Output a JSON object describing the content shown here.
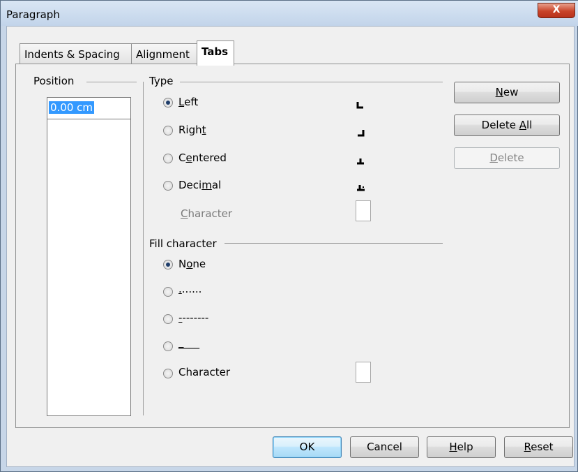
{
  "window": {
    "title": "Paragraph",
    "close_label": "X"
  },
  "tabs": [
    {
      "label": "Indents & Spacing",
      "active": false
    },
    {
      "label": "Alignment",
      "active": false
    },
    {
      "label": "Tabs",
      "active": true
    }
  ],
  "position": {
    "label": "Position",
    "value": "0.00 cm"
  },
  "type": {
    "label": "Type",
    "options": [
      {
        "pre": "",
        "mn": "L",
        "post": "eft",
        "checked": true,
        "icon": "left-tab-icon"
      },
      {
        "pre": "Righ",
        "mn": "t",
        "post": "",
        "checked": false,
        "icon": "right-tab-icon"
      },
      {
        "pre": "C",
        "mn": "e",
        "post": "ntered",
        "checked": false,
        "icon": "centered-tab-icon"
      },
      {
        "pre": "Deci",
        "mn": "m",
        "post": "al",
        "checked": false,
        "icon": "decimal-tab-icon"
      }
    ],
    "character_label_mn": "C",
    "character_label_rest": "haracter"
  },
  "fill": {
    "label": "Fill character",
    "options": [
      {
        "pre": "N",
        "mn": "o",
        "post": "ne",
        "checked": true
      },
      {
        "pre": "",
        "mn": ".",
        "post": "......",
        "checked": false
      },
      {
        "pre": "",
        "mn": "-",
        "post": "-------",
        "checked": false
      },
      {
        "pre": "",
        "mn": "_",
        "post": "___",
        "checked": false
      },
      {
        "pre": "Character",
        "mn": "",
        "post": "",
        "checked": false
      }
    ]
  },
  "buttons": {
    "new": {
      "pre": "",
      "mn": "N",
      "post": "ew"
    },
    "delete_all": {
      "pre": "Delete ",
      "mn": "A",
      "post": "ll"
    },
    "delete": {
      "pre": "",
      "mn": "D",
      "post": "elete"
    }
  },
  "footer": {
    "ok": "OK",
    "cancel": "Cancel",
    "help": {
      "pre": "",
      "mn": "H",
      "post": "elp"
    },
    "reset": {
      "pre": "",
      "mn": "R",
      "post": "eset"
    }
  },
  "colors": {
    "selection": "#3399ff",
    "close_button": "#c9442a"
  }
}
